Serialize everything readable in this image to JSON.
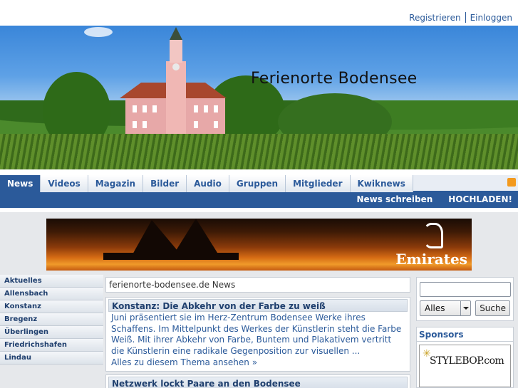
{
  "top_links": {
    "register": "Registrieren",
    "login": "Einloggen"
  },
  "site_title": "Ferienorte Bodensee",
  "nav": {
    "tabs": [
      "News",
      "Videos",
      "Magazin",
      "Bilder",
      "Audio",
      "Gruppen",
      "Mitglieder",
      "Kwiknews"
    ],
    "active": "News"
  },
  "subnav": {
    "write_news": "News schreiben",
    "upload": "HOCHLADEN!"
  },
  "ad": {
    "brand": "Emirates"
  },
  "left_menu": [
    "Aktuelles",
    "Allensbach",
    "Konstanz",
    "Bregenz",
    "Überlingen",
    "Friedrichshafen",
    "Lindau"
  ],
  "main": {
    "crumb": "ferienorte-bodensee.de News",
    "articles": [
      {
        "title": "Konstanz: Die Abkehr von der Farbe zu weiß",
        "text": "Juni präsentiert sie im Herz-Zentrum Bodensee Werke ihres Schaffens. Im Mittelpunkt des Werkes der Künstlerin steht die Farbe Weiß. Mit ihrer Abkehr von Farbe, Buntem und Plakativem vertritt die Künstlerin eine radikale Gegenposition zur visuellen ...",
        "more": "Alles zu diesem Thema ansehen »"
      },
      {
        "title": "Netzwerk lockt Paare an den Bodensee"
      }
    ]
  },
  "search": {
    "select_value": "Alles",
    "button": "Suche"
  },
  "sponsors": {
    "heading": "Sponsors",
    "ad_text": "STYLEBOP.com"
  },
  "colors": {
    "accent": "#2b5a9a",
    "nav_bg": "#e8edf4",
    "frame_bg": "#e6e8eb"
  }
}
